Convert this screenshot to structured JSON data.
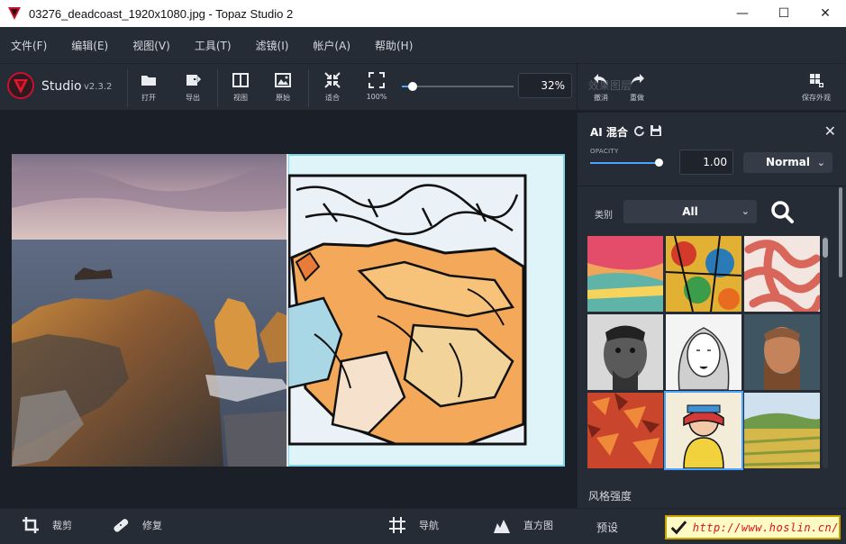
{
  "window": {
    "title": "03276_deadcoast_1920x1080.jpg - Topaz Studio 2",
    "minimize": "—",
    "maximize": "☐",
    "close": "✕"
  },
  "menu": [
    "文件(F)",
    "编辑(E)",
    "视图(V)",
    "工具(T)",
    "滤镜(I)",
    "帐户(A)",
    "帮助(H)"
  ],
  "toolbar": {
    "app_name": "Studio",
    "version": "v2.3.2",
    "tools": [
      {
        "icon": "folder-icon",
        "label": "打开"
      },
      {
        "icon": "export-icon",
        "label": "导出"
      },
      {
        "icon": "view-split-icon",
        "label": "视图"
      },
      {
        "icon": "original-image-icon",
        "label": "原始"
      },
      {
        "icon": "fit-icon",
        "label": "适合"
      },
      {
        "icon": "zoom-100-icon",
        "label": "100%"
      }
    ],
    "zoom_value": "32%",
    "zoom_fraction": 0.1,
    "ghost_label": "效果图层",
    "undo_label": "撤消",
    "redo_label": "重做",
    "save_look_label": "保存外观"
  },
  "panel": {
    "title": "AI 混合",
    "opacity_label": "OPACITY",
    "opacity_value": "1.00",
    "opacity_fraction": 1.0,
    "blend_mode": "Normal",
    "category_label": "类别",
    "category_value": "All",
    "strength_label": "风格强度",
    "selected_thumb": 7
  },
  "bottom": {
    "crop": "裁剪",
    "repair": "修复",
    "navigator": "导航",
    "histogram": "直方图",
    "preset": "预设",
    "watermark_url": "http://www.hoslin.cn/"
  },
  "colors": {
    "accent": "#4aa3ff",
    "panel_bg": "#262c36",
    "canvas_bg": "#1b1f27",
    "logo_red": "#c8102e"
  }
}
